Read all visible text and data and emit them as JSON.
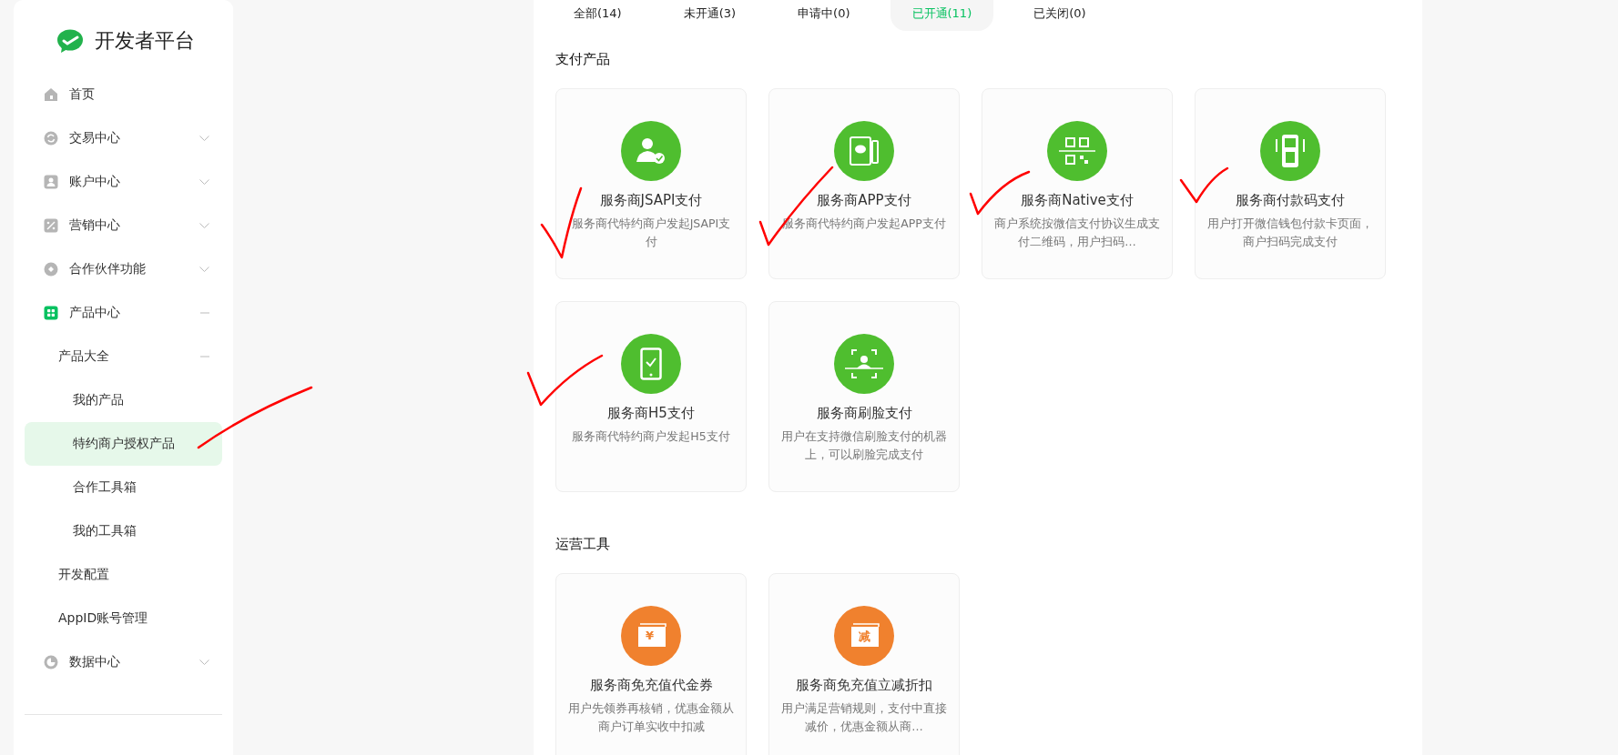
{
  "brand": {
    "name": "开发者平台"
  },
  "sidebar": {
    "items": [
      {
        "label": "首页",
        "kind": "home",
        "selected": false
      },
      {
        "label": "交易中心",
        "kind": "exchange",
        "selected": false,
        "expanded": false
      },
      {
        "label": "账户中心",
        "kind": "account",
        "selected": false,
        "expanded": false
      },
      {
        "label": "营销中心",
        "kind": "percent",
        "selected": false,
        "expanded": false
      },
      {
        "label": "合作伙伴功能",
        "kind": "partner",
        "selected": false,
        "expanded": false
      },
      {
        "label": "产品中心",
        "kind": "grid",
        "selected": false,
        "expanded": true,
        "children": [
          {
            "label": "产品大全",
            "selected": false,
            "expanded": true,
            "children": [
              {
                "label": "我的产品",
                "selected": false
              },
              {
                "label": "特约商户授权产品",
                "selected": true
              },
              {
                "label": "合作工具箱",
                "selected": false
              },
              {
                "label": "我的工具箱",
                "selected": false
              }
            ]
          },
          {
            "label": "开发配置",
            "selected": false
          },
          {
            "label": "AppID账号管理",
            "selected": false
          }
        ]
      },
      {
        "label": "数据中心",
        "kind": "chart",
        "selected": false,
        "expanded": false
      }
    ]
  },
  "tabs": [
    {
      "label": "全部(14)",
      "selected": false
    },
    {
      "label": "未开通(3)",
      "selected": false
    },
    {
      "label": "申请中(0)",
      "selected": false
    },
    {
      "label": "已开通(11)",
      "selected": true
    },
    {
      "label": "已关闭(0)",
      "selected": false
    }
  ],
  "sections": [
    {
      "title": "支付产品",
      "kind": "payment",
      "products": [
        {
          "kind": "person-check",
          "title": "服务商JSAPI支付",
          "description": "服务商代特约商户发起JSAPI支付"
        },
        {
          "kind": "tablet",
          "title": "服务商APP支付",
          "description": "服务商代特约商户发起APP支付"
        },
        {
          "kind": "qr",
          "title": "服务商Native支付",
          "description": "商户系统按微信支付协议生成支付二维码，用户扫码…"
        },
        {
          "kind": "terminal",
          "title": "服务商付款码支付",
          "description": "用户打开微信钱包付款卡页面，商户扫码完成支付"
        },
        {
          "kind": "phone-check",
          "title": "服务商H5支付",
          "description": "服务商代特约商户发起H5支付"
        },
        {
          "kind": "face",
          "title": "服务商刷脸支付",
          "description": "用户在支持微信刷脸支付的机器上，可以刷脸完成支付"
        }
      ]
    },
    {
      "title": "运营工具",
      "kind": "operations",
      "products": [
        {
          "kind": "coupon",
          "badge": "¥",
          "title": "服务商免充值代金券",
          "description": "用户先领券再核销，优惠金额从商户订单实收中扣减"
        },
        {
          "kind": "coupon",
          "badge": "减",
          "title": "服务商免充值立减折扣",
          "description": "用户满足营销规则，支付中直接减价，优惠金额从商…"
        }
      ]
    }
  ]
}
